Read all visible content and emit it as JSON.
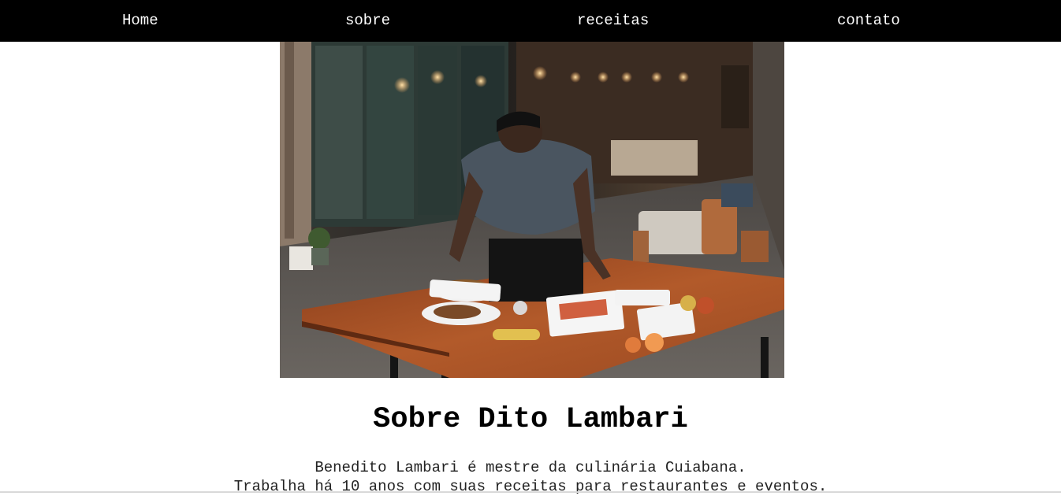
{
  "nav": {
    "home": "Home",
    "sobre": "sobre",
    "receitas": "receitas",
    "contato": "contato"
  },
  "hero_image": {
    "alt": "Chef plating dishes on a wooden table in a restaurant"
  },
  "about": {
    "title": "Sobre Dito Lambari",
    "line1": "Benedito Lambari é mestre da culinária Cuiabana.",
    "line2": "Trabalha há 10 anos com suas receitas para restaurantes e eventos."
  },
  "colors": {
    "nav_background": "#000000",
    "nav_text": "#ffffff",
    "page_background": "#ffffff"
  }
}
